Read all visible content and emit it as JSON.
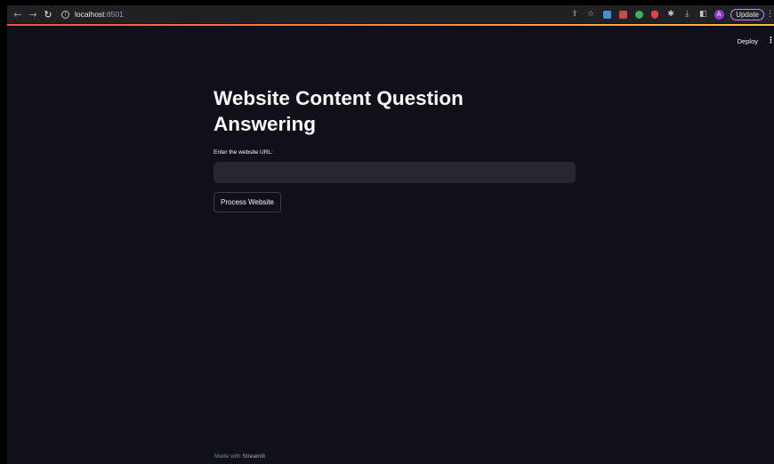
{
  "browser": {
    "url_host": "localhost",
    "url_port": ":8501",
    "avatar_initial": "A",
    "update_label": "Update"
  },
  "header": {
    "deploy_label": "Deploy"
  },
  "main": {
    "title_line1": "Website Content Question",
    "title_line2": "Answering",
    "url_label": "Enter the website URL:",
    "url_value": "",
    "url_placeholder": "",
    "process_button_label": "Process Website"
  },
  "footer": {
    "prefix": "Made with ",
    "brand": "Streamlit"
  },
  "colors": {
    "background": "#0e1117",
    "input_bg": "#262730",
    "accent_gradient_start": "#ff4b4b",
    "accent_gradient_end": "#ffbd45"
  }
}
